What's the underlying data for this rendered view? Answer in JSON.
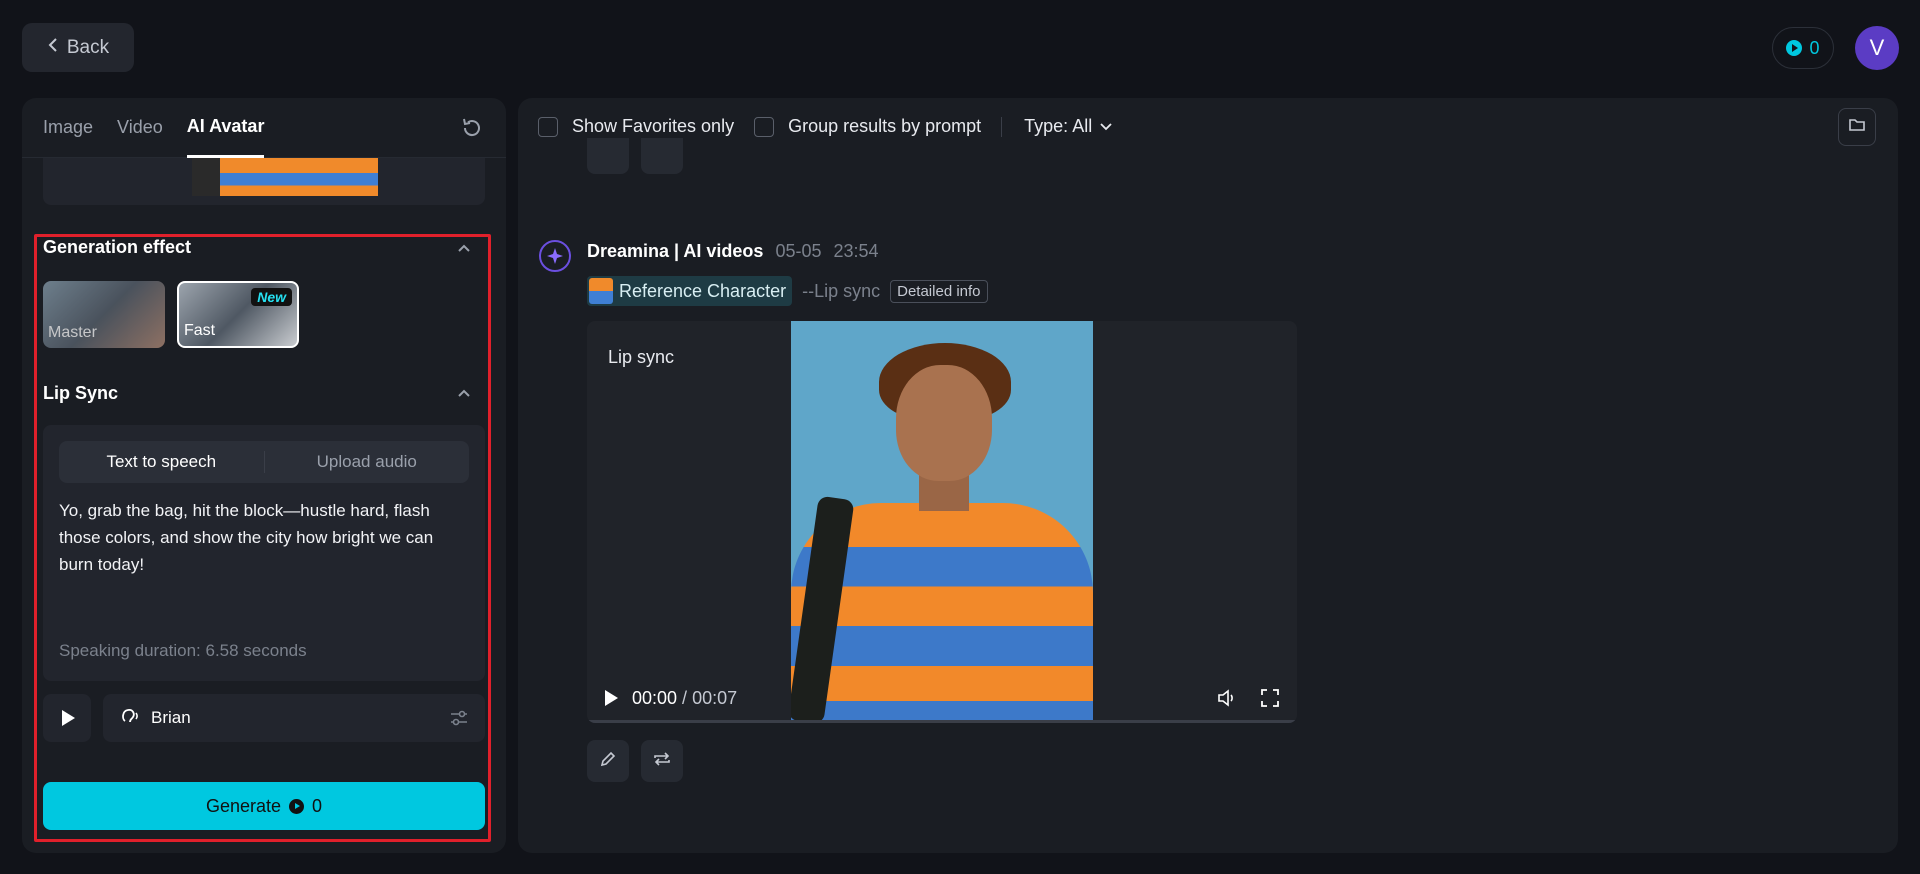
{
  "header": {
    "back_label": "Back",
    "credits": "0",
    "avatar_initial": "V"
  },
  "left": {
    "tabs": [
      {
        "label": "Image",
        "active": false
      },
      {
        "label": "Video",
        "active": false
      },
      {
        "label": "AI Avatar",
        "active": true
      }
    ],
    "generation_effect": {
      "title": "Generation effect",
      "options": [
        {
          "label": "Master",
          "selected": false
        },
        {
          "label": "Fast",
          "selected": true,
          "badge": "New"
        }
      ]
    },
    "lip_sync": {
      "title": "Lip Sync",
      "modes": [
        "Text to speech",
        "Upload audio"
      ],
      "active_mode": "Text to speech",
      "text": "Yo, grab the bag, hit the block—hustle hard, flash those colors, and show the city how bright we can burn today!",
      "duration": "Speaking duration: 6.58 seconds",
      "voice": "Brian"
    },
    "generate": {
      "label": "Generate",
      "cost": "0"
    }
  },
  "right": {
    "filters": {
      "favorites": "Show Favorites only",
      "group": "Group results by prompt",
      "type": "Type: All"
    },
    "post": {
      "author": "Dreamina | AI videos",
      "date": "05-05",
      "time": "23:54",
      "character_chip": "Reference Character",
      "mode": "--Lip sync",
      "detail": "Detailed info",
      "video_label": "Lip sync",
      "current_time": "00:00",
      "separator": "/",
      "duration": "00:07",
      "progress": 0
    }
  },
  "colors": {
    "accent": "#00c8e0",
    "highlight_border": "#e0202b",
    "brand_purple": "#6b4fe0"
  }
}
